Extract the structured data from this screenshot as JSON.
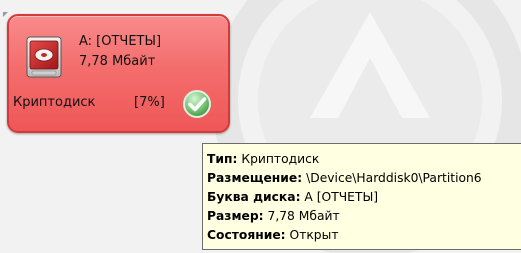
{
  "drive": {
    "name": "A: [ОТЧЕТЫ]",
    "size": "7,78 Мбайт",
    "type_label": "Криптодиск",
    "percent": "[7%]",
    "status_icon": "green-checkmark-icon",
    "tile_color": "#f46d6d",
    "border_color": "#d43a3a"
  },
  "tooltip": {
    "rows": [
      {
        "label": "Тип:",
        "value": "Криптодиск"
      },
      {
        "label": "Размещение:",
        "value": "\\Device\\Harddisk0\\Partition6"
      },
      {
        "label": "Буква диска:",
        "value": "A [ОТЧЕТЫ]"
      },
      {
        "label": "Размер:",
        "value": "7,78 Мбайт"
      },
      {
        "label": "Состояние:",
        "value": "Открыт"
      }
    ],
    "background": "#ffffe1"
  }
}
